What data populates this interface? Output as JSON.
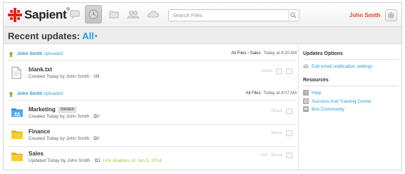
{
  "app": {
    "brand": "Sapient",
    "brand_mark": "®"
  },
  "nav": {
    "icons": [
      "chat-icon",
      "updates-icon",
      "files-icon",
      "people-icon",
      "cloud-icon"
    ],
    "active": "updates-icon"
  },
  "search": {
    "placeholder": "Search Files"
  },
  "user": {
    "name": "John Smith"
  },
  "header": {
    "title": "Recent updates:",
    "filter": "All",
    "caret": "▾"
  },
  "feed": {
    "groups": [
      {
        "user": "John Smith",
        "action": "uploaded",
        "path": "All Files › Sales",
        "time": "Today at 4:20 AM",
        "items": [
          {
            "name": "blank.txt",
            "meta": "Created Today by John Smith",
            "extra": "0B",
            "type": "file",
            "share": "Share"
          }
        ]
      },
      {
        "user": "John Smith",
        "action": "uploaded",
        "path": "All Files",
        "time": "Today at 4:07 AM",
        "items": [
          {
            "name": "Marketing",
            "badge": "OWNER",
            "meta": "Created Today by John Smith",
            "extra": "0",
            "type": "shared-folder",
            "share": "Share"
          },
          {
            "name": "Finance",
            "meta": "Created Today by John Smith",
            "extra": "0",
            "type": "folder",
            "share": "Share"
          },
          {
            "name": "Sales",
            "meta": "Updated Today by John Smith",
            "extra": "1",
            "link_note": "Link disables on Jan 5, 2014",
            "type": "folder",
            "share": "Share",
            "share_prefix": "###"
          }
        ]
      }
    ]
  },
  "sidebar": {
    "updates_title": "Updates Options",
    "updates_links": [
      {
        "label": "Edit email notification settings",
        "icon": "mail-icon"
      }
    ],
    "resources_title": "Resources",
    "resources_links": [
      {
        "label": "Help",
        "icon": "help-icon"
      },
      {
        "label": "Success And Training Corner",
        "icon": "training-icon"
      },
      {
        "label": "Box Community",
        "icon": "community-icon"
      }
    ]
  },
  "colors": {
    "accent": "#2b9bcf",
    "user": "#e04a1a",
    "brand": "#e2231a",
    "link_note": "#a5c84a"
  }
}
